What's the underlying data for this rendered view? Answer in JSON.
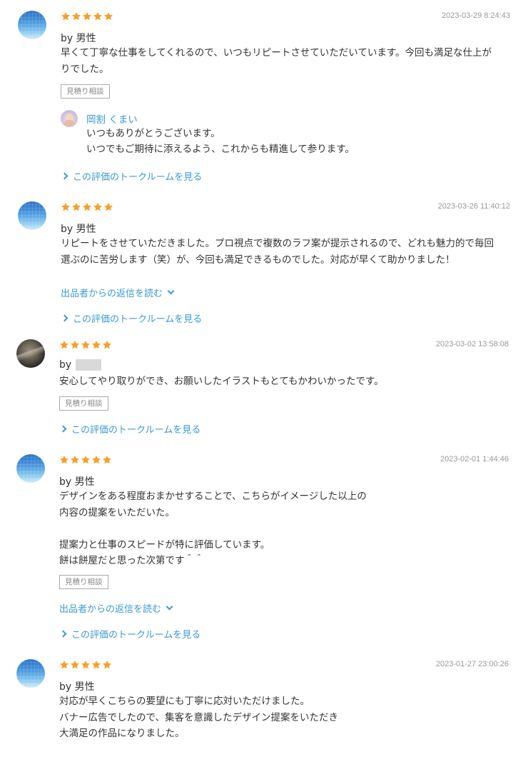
{
  "colors": {
    "star": "#f5a02a",
    "link": "#3a9bcf",
    "date": "#999999",
    "tag_border": "#aaaaaa"
  },
  "reviews": [
    {
      "rating": 5,
      "date": "2023-03-29 8:24:43",
      "by": "by 男性",
      "body": [
        "早くて丁寧な仕事をしてくれるので、いつもリピートさせていただいています。今回も満足な仕上が",
        "りでした。"
      ],
      "tag": "見積り相談",
      "reply": {
        "name": "岡割 くまい",
        "lines": [
          "いつもありがとうございます。",
          "いつでもご期待に添えるよう、これからも精進して参ります。"
        ]
      },
      "talkroom_link": "この評価のトークルームを見る"
    },
    {
      "rating": 5,
      "date": "2023-03-26 11:40:12",
      "by": "by 男性",
      "body": [
        "リピートをさせていただきました。プロ視点で複数のラフ案が提示されるので、どれも魅力的で毎回",
        "選ぶのに苦労します（笑）が、今回も満足できるものでした。対応が早くて助かりました！"
      ],
      "read_reply_link": "出品者からの返信を読む",
      "talkroom_link": "この評価のトークルームを見る"
    },
    {
      "rating": 5,
      "date": "2023-03-02 13:58:08",
      "by": "by",
      "body": [
        "安心してやり取りができ、お願いしたイラストもとてもかわいかったです。"
      ],
      "tag": "見積り相談",
      "talkroom_link": "この評価のトークルームを見る"
    },
    {
      "rating": 5,
      "date": "2023-02-01 1:44:46",
      "by": "by 男性",
      "body": [
        "デザインをある程度おまかせすることで、こちらがイメージした以上の",
        "内容の提案をいただいた。",
        "",
        "提案力と仕事のスピードが特に評価しています。",
        "餅は餅屋だと思った次第です＾＾"
      ],
      "tag": "見積り相談",
      "read_reply_link": "出品者からの返信を読む",
      "talkroom_link": "この評価のトークルームを見る"
    },
    {
      "rating": 5,
      "date": "2023-01-27 23:00:26",
      "by": "by 男性",
      "body": [
        "対応が早くこちらの要望にも丁寧に応対いただけました。",
        "バナー広告でしたので、集客を意識したデザイン提案をいただき",
        "大満足の作品になりました。"
      ]
    }
  ]
}
